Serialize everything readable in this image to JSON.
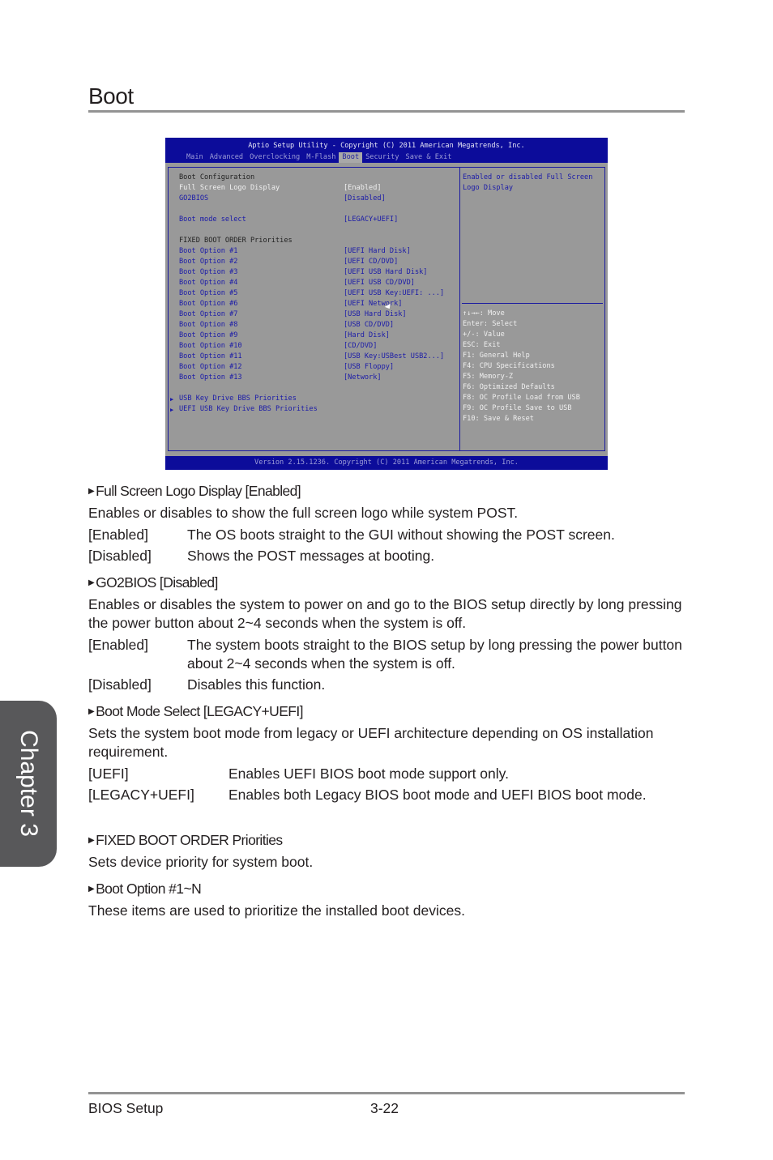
{
  "page": {
    "title": "Boot",
    "chapter_tab": "Chapter 3",
    "footer_left": "BIOS Setup",
    "footer_page": "3-22"
  },
  "bios": {
    "header_title": "Aptio Setup Utility - Copyright (C) 2011 American Megatrends, Inc.",
    "tabs": [
      "Main",
      "Advanced",
      "Overclocking",
      "M-Flash",
      "Boot",
      "Security",
      "Save & Exit"
    ],
    "active_tab": "Boot",
    "items": [
      {
        "label": "Boot Configuration",
        "value": "",
        "style": "heading"
      },
      {
        "label": "Full Screen Logo Display",
        "value": "[Enabled]",
        "style": "selected"
      },
      {
        "label": "GO2BIOS",
        "value": "[Disabled]",
        "style": "option"
      },
      {
        "label": "Boot mode select",
        "value": "[LEGACY+UEFI]",
        "style": "option"
      },
      {
        "label": "FIXED BOOT ORDER Priorities",
        "value": "",
        "style": "heading"
      },
      {
        "label": "Boot Option #1",
        "value": "[UEFI Hard Disk]",
        "style": "option"
      },
      {
        "label": "Boot Option #2",
        "value": "[UEFI CD/DVD]",
        "style": "option"
      },
      {
        "label": "Boot Option #3",
        "value": "[UEFI USB Hard Disk]",
        "style": "option"
      },
      {
        "label": "Boot Option #4",
        "value": "[UEFI USB CD/DVD]",
        "style": "option"
      },
      {
        "label": "Boot Option #5",
        "value": "[UEFI USB Key:UEFI: ...]",
        "style": "option"
      },
      {
        "label": "Boot Option #6",
        "value": "[UEFI Network]",
        "style": "option"
      },
      {
        "label": "Boot Option #7",
        "value": "[USB Hard Disk]",
        "style": "option"
      },
      {
        "label": "Boot Option #8",
        "value": "[USB CD/DVD]",
        "style": "option"
      },
      {
        "label": "Boot Option #9",
        "value": "[Hard Disk]",
        "style": "option"
      },
      {
        "label": "Boot Option #10",
        "value": "[CD/DVD]",
        "style": "option"
      },
      {
        "label": "Boot Option #11",
        "value": "[USB Key:USBest USB2...]",
        "style": "option"
      },
      {
        "label": "Boot Option #12",
        "value": "[USB Floppy]",
        "style": "option"
      },
      {
        "label": "Boot Option #13",
        "value": "[Network]",
        "style": "option"
      }
    ],
    "submenus": [
      "USB Key Drive BBS Priorities",
      "UEFI USB Key Drive BBS Priorities"
    ],
    "help_text": "Enabled or disabled Full Screen Logo Display",
    "keys": [
      "↑↓→←: Move",
      "Enter: Select",
      "+/-: Value",
      "ESC: Exit",
      "F1: General Help",
      "F4: CPU Specifications",
      "F5: Memory-Z",
      "F6: Optimized Defaults",
      "F8: OC Profile Load from USB",
      "F9: OC Profile Save to USB",
      "F10: Save & Reset"
    ],
    "footer": "Version 2.15.1236. Copyright (C) 2011 American Megatrends, Inc."
  },
  "sections": [
    {
      "heading": "Full Screen Logo Display [Enabled]",
      "description": "Enables or disables to show the full screen logo while system POST.",
      "options": [
        {
          "key": "[Enabled]",
          "text": "The OS boots straight to the GUI without showing the POST screen."
        },
        {
          "key": "[Disabled]",
          "text": "Shows the POST messages at booting."
        }
      ]
    },
    {
      "heading": "GO2BIOS [Disabled]",
      "description": "Enables or disables the system to power on and go to the BIOS setup directly by long pressing the power button about 2~4 seconds when the system is off.",
      "options": [
        {
          "key": "[Enabled]",
          "text": "The system boots straight to the BIOS setup by long pressing the power button about 2~4 seconds when the system is off."
        },
        {
          "key": "[Disabled]",
          "text": "Disables this function."
        }
      ]
    },
    {
      "heading": "Boot Mode Select [LEGACY+UEFI]",
      "description": "Sets the system boot mode from legacy or UEFI architecture depending on OS installation requirement.",
      "options": [
        {
          "key": "[UEFI]",
          "text": "Enables UEFI BIOS boot mode support only."
        },
        {
          "key": "[LEGACY+UEFI]",
          "text": "Enables both Legacy BIOS boot mode and UEFI BIOS boot mode."
        }
      ]
    },
    {
      "heading": "FIXED BOOT ORDER Priorities",
      "description": "Sets device priority for system boot.",
      "options": []
    },
    {
      "heading": "Boot Option #1~N",
      "description": "These items are used to prioritize the installed boot devices.",
      "options": []
    }
  ]
}
